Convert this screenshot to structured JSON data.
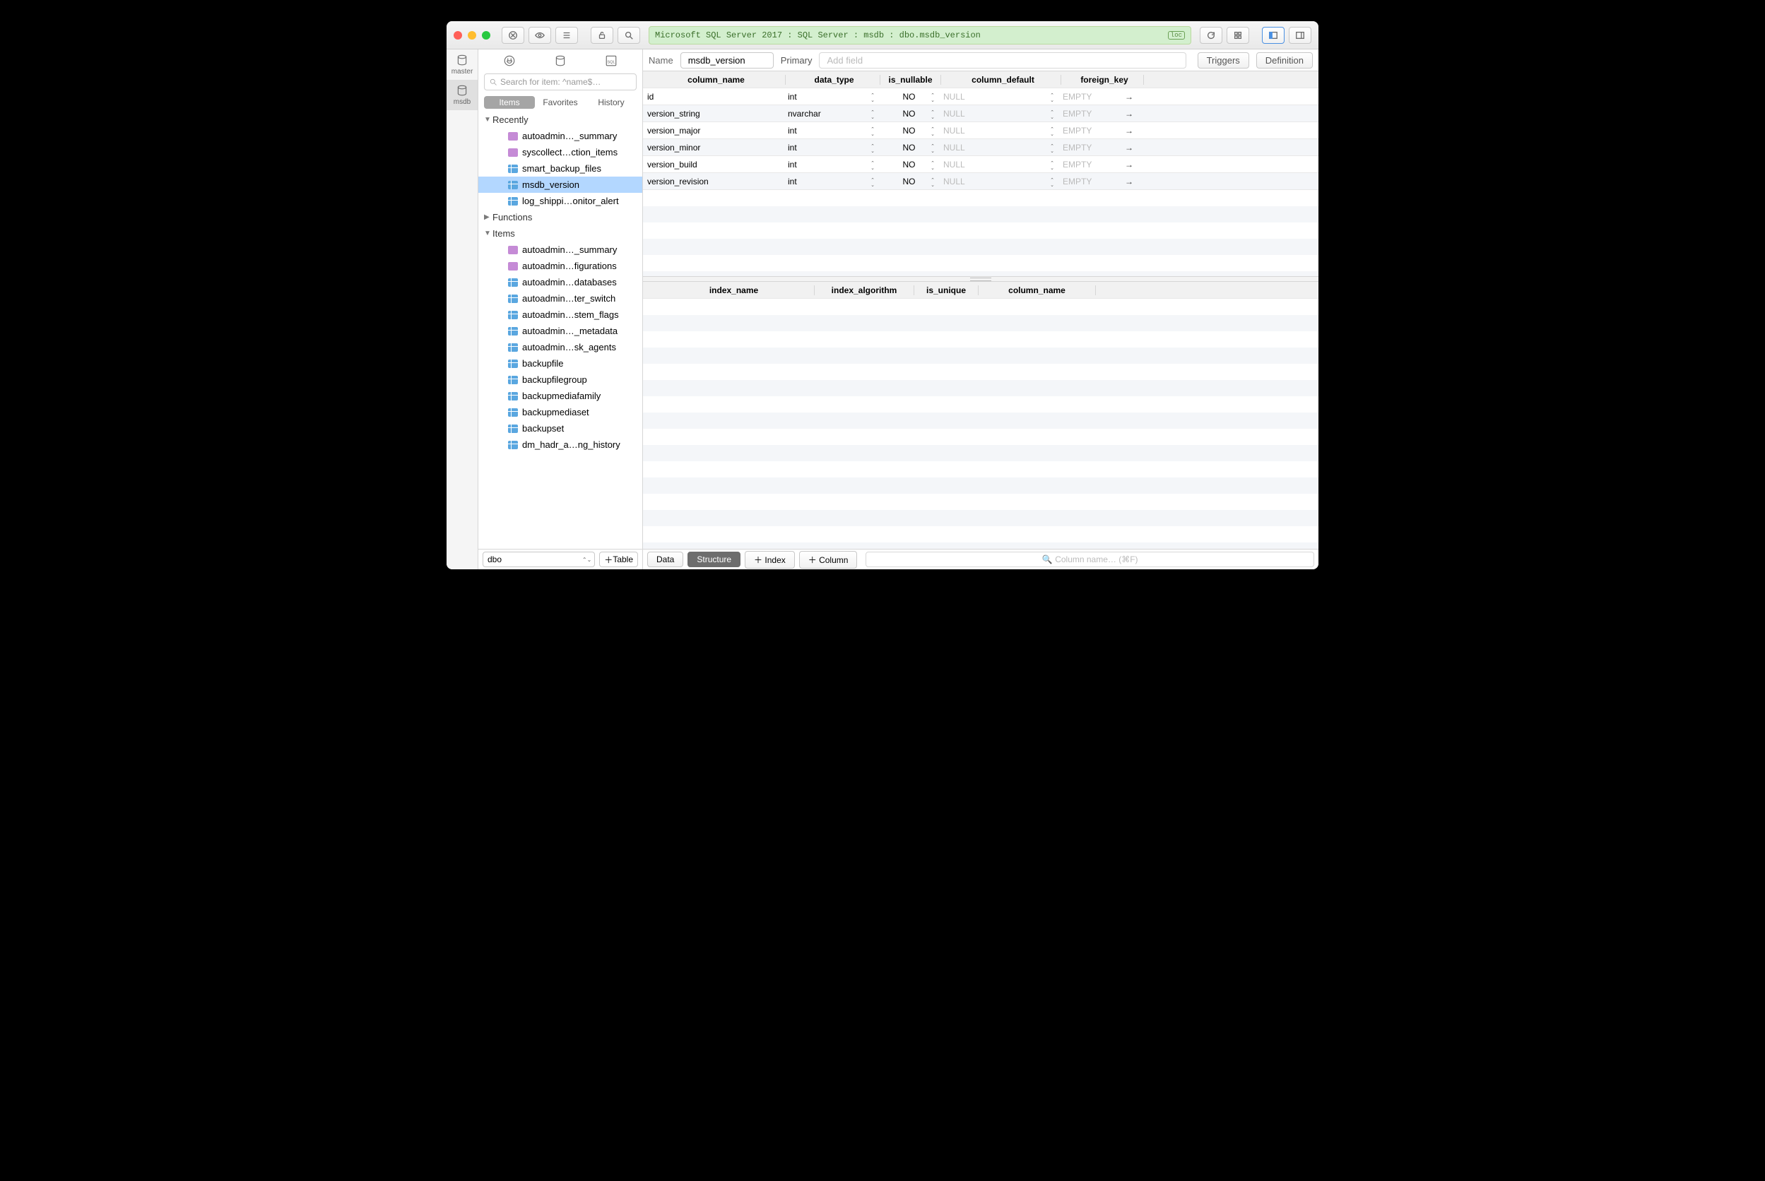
{
  "toolbar": {
    "breadcrumb": "Microsoft SQL Server 2017 : SQL Server : msdb : dbo.msdb_version",
    "loc_badge": "loc"
  },
  "rail": {
    "items": [
      {
        "label": "master"
      },
      {
        "label": "msdb"
      }
    ]
  },
  "sidebar": {
    "search_placeholder": "Search for item: ^name$…",
    "tabs": {
      "items": "Items",
      "favorites": "Favorites",
      "history": "History"
    },
    "recently_label": "Recently",
    "recently": [
      {
        "icon": "view",
        "label": "autoadmin…_summary"
      },
      {
        "icon": "view",
        "label": "syscollect…ction_items"
      },
      {
        "icon": "table",
        "label": "smart_backup_files"
      },
      {
        "icon": "table",
        "label": "msdb_version"
      },
      {
        "icon": "table",
        "label": "log_shippi…onitor_alert"
      }
    ],
    "functions_label": "Functions",
    "items_label": "Items",
    "items": [
      {
        "icon": "view",
        "label": "autoadmin…_summary"
      },
      {
        "icon": "view",
        "label": "autoadmin…figurations"
      },
      {
        "icon": "table",
        "label": "autoadmin…databases"
      },
      {
        "icon": "table",
        "label": "autoadmin…ter_switch"
      },
      {
        "icon": "table",
        "label": "autoadmin…stem_flags"
      },
      {
        "icon": "table",
        "label": "autoadmin…_metadata"
      },
      {
        "icon": "table",
        "label": "autoadmin…sk_agents"
      },
      {
        "icon": "table",
        "label": "backupfile"
      },
      {
        "icon": "table",
        "label": "backupfilegroup"
      },
      {
        "icon": "table",
        "label": "backupmediafamily"
      },
      {
        "icon": "table",
        "label": "backupmediaset"
      },
      {
        "icon": "table",
        "label": "backupset"
      },
      {
        "icon": "table",
        "label": "dm_hadr_a…ng_history"
      }
    ],
    "schema_combo": "dbo",
    "add_table": "Table"
  },
  "header": {
    "name_label": "Name",
    "name_value": "msdb_version",
    "primary": "Primary",
    "add_field_placeholder": "Add field",
    "triggers": "Triggers",
    "definition": "Definition"
  },
  "columns_table": {
    "headers": {
      "name": "column_name",
      "type": "data_type",
      "nullable": "is_nullable",
      "default": "column_default",
      "fk": "foreign_key"
    },
    "rows": [
      {
        "name": "id",
        "type": "int",
        "nullable": "NO",
        "default": "NULL",
        "fk": "EMPTY"
      },
      {
        "name": "version_string",
        "type": "nvarchar",
        "nullable": "NO",
        "default": "NULL",
        "fk": "EMPTY"
      },
      {
        "name": "version_major",
        "type": "int",
        "nullable": "NO",
        "default": "NULL",
        "fk": "EMPTY"
      },
      {
        "name": "version_minor",
        "type": "int",
        "nullable": "NO",
        "default": "NULL",
        "fk": "EMPTY"
      },
      {
        "name": "version_build",
        "type": "int",
        "nullable": "NO",
        "default": "NULL",
        "fk": "EMPTY"
      },
      {
        "name": "version_revision",
        "type": "int",
        "nullable": "NO",
        "default": "NULL",
        "fk": "EMPTY"
      }
    ]
  },
  "index_table": {
    "headers": {
      "name": "index_name",
      "algo": "index_algorithm",
      "unique": "is_unique",
      "col": "column_name"
    }
  },
  "footer": {
    "data": "Data",
    "structure": "Structure",
    "index": "Index",
    "column": "Column",
    "filter_placeholder": "Column name… (⌘F)"
  }
}
